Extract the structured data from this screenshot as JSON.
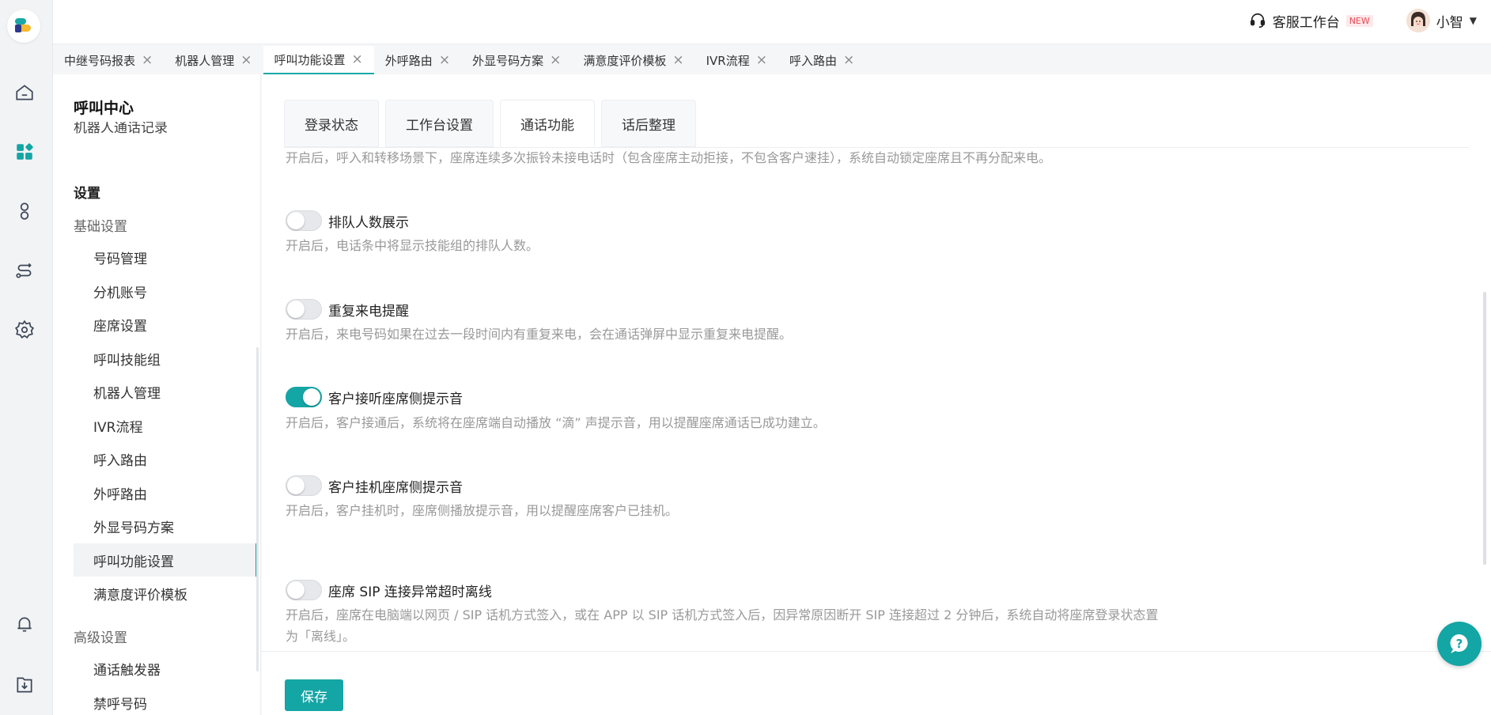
{
  "header": {
    "service_desk_label": "客服工作台",
    "new_badge": "NEW",
    "user_name": "小智"
  },
  "tabs": [
    {
      "label": "中继号码报表"
    },
    {
      "label": "机器人管理"
    },
    {
      "label": "呼叫功能设置",
      "active": true
    },
    {
      "label": "外呼路由"
    },
    {
      "label": "外显号码方案"
    },
    {
      "label": "满意度评价模板"
    },
    {
      "label": "IVR流程"
    },
    {
      "label": "呼入路由"
    }
  ],
  "sidebar": {
    "title": "呼叫中心",
    "partial_item": "机器人通话记录",
    "settings_group": "设置",
    "basic_settings": "基础设置",
    "items": [
      {
        "label": "号码管理"
      },
      {
        "label": "分机账号"
      },
      {
        "label": "座席设置"
      },
      {
        "label": "呼叫技能组"
      },
      {
        "label": "机器人管理"
      },
      {
        "label": "IVR流程"
      },
      {
        "label": "呼入路由"
      },
      {
        "label": "外呼路由"
      },
      {
        "label": "外显号码方案"
      },
      {
        "label": "呼叫功能设置",
        "active": true
      },
      {
        "label": "满意度评价模板"
      }
    ],
    "advanced_settings": "高级设置",
    "advanced_items": [
      {
        "label": "通话触发器"
      },
      {
        "label": "禁呼号码"
      }
    ]
  },
  "subtabs": [
    {
      "label": "登录状态"
    },
    {
      "label": "工作台设置"
    },
    {
      "label": "通话功能",
      "active": true
    },
    {
      "label": "话后整理"
    }
  ],
  "settings": {
    "top_desc": "开启后，呼入和转移场景下，座席连续多次振铃未接电话时（包含座席主动拒接，不包含客户速挂），系统自动锁定座席且不再分配来电。",
    "items": [
      {
        "label": "排队人数展示",
        "on": false,
        "desc": "开启后，电话条中将显示技能组的排队人数。"
      },
      {
        "label": "重复来电提醒",
        "on": false,
        "desc": "开启后，来电号码如果在过去一段时间内有重复来电，会在通话弹屏中显示重复来电提醒。"
      },
      {
        "label": "客户接听座席侧提示音",
        "on": true,
        "desc": "开启后，客户接通后，系统将在座席端自动播放 “滴” 声提示音，用以提醒座席通话已成功建立。"
      },
      {
        "label": "客户挂机座席侧提示音",
        "on": false,
        "desc": "开启后，客户挂机时，座席侧播放提示音，用以提醒座席客户已挂机。"
      },
      {
        "label": "座席 SIP 连接异常超时离线",
        "on": false,
        "desc": "开启后，座席在电脑端以网页 / SIP 话机方式签入，或在 APP 以 SIP 话机方式签入后，因异常原因断开 SIP 连接超过 2 分钟后，系统自动将座席登录状态置",
        "desc2": "为「离线」。"
      }
    ]
  },
  "footer": {
    "save_label": "保存"
  },
  "colors": {
    "accent": "#14a5a5",
    "badge_red": "#e34d59"
  }
}
